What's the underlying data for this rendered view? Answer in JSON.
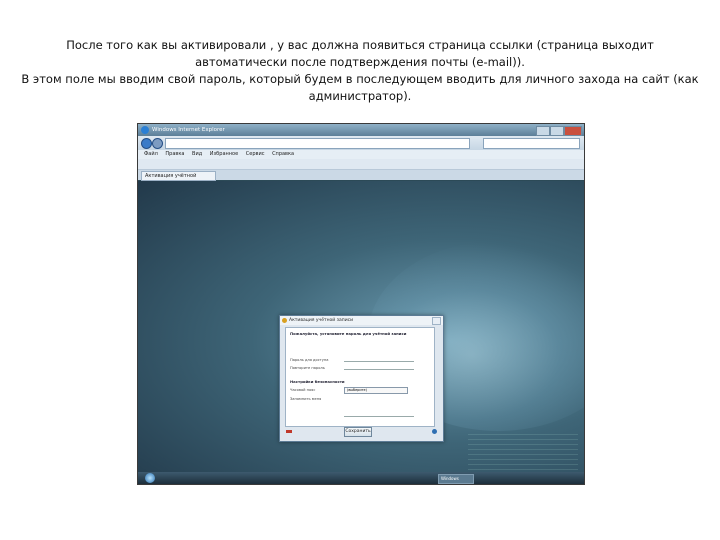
{
  "caption": {
    "paragraph1": "После того как вы активировали , у вас должна появиться страница ссылки (страница выходит автоматически после подтверждения почты (e-mail)).",
    "paragraph2": "В этом поле мы вводим свой пароль, который будем в последующем вводить для личного захода на сайт (как администратор)."
  },
  "screenshot": {
    "window_title": "Windows Internet Explorer",
    "menu_items": [
      "Файл",
      "Правка",
      "Вид",
      "Избранное",
      "Сервис",
      "Справка"
    ],
    "tab_label": "Активация учётной записи",
    "dialog": {
      "title": "Активация учётной записи",
      "section1": "Пожалуйста, установите пароль для учётной записи",
      "password_label": "Пароль для доступа",
      "confirm_label": "Повторите пароль",
      "section2": "Настройки безопасности",
      "timezone_label": "Часовой пояс",
      "select_value": "(выберите)",
      "option_label": "Запомнить меня",
      "button_label": "Сохранить"
    },
    "taskbar_item": "Windows"
  }
}
